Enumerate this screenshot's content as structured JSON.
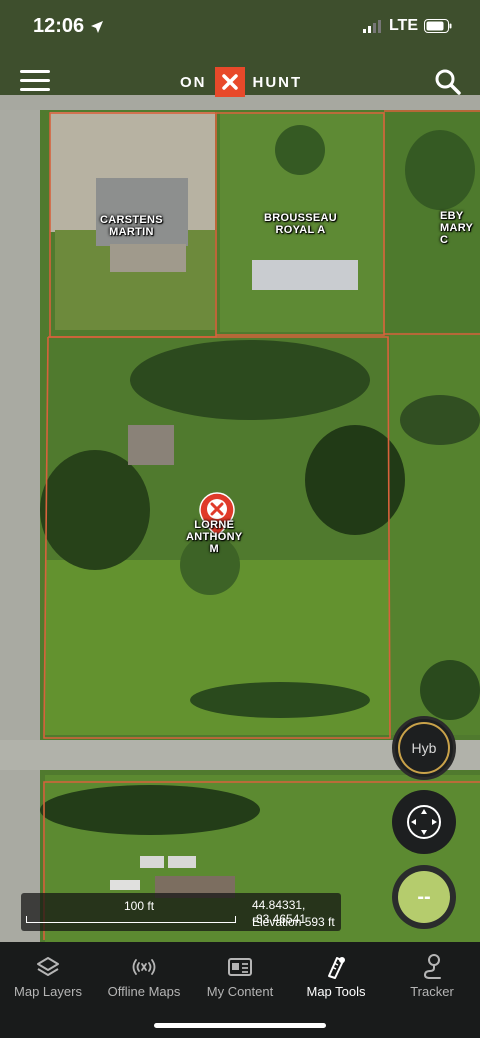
{
  "status_bar": {
    "time": "12:06",
    "network": "LTE"
  },
  "header": {
    "logo_left": "ON",
    "logo_right": "HUNT"
  },
  "parcels": [
    {
      "name": "CARSTENS\nMARTIN"
    },
    {
      "name": "BROUSSEAU\nROYAL A"
    },
    {
      "name": "EBY\nMARY C"
    },
    {
      "name": "LORNE\nANTHONY\nM"
    }
  ],
  "map_controls": {
    "layer_button": "Hyb",
    "gps_button": "--"
  },
  "scale": {
    "label": "100 ft"
  },
  "location": {
    "coords": "44.84331, -83.46541",
    "elevation": "Elevation 593 ft"
  },
  "tabs": [
    {
      "label": "Map Layers",
      "icon": "layers-icon",
      "active": false
    },
    {
      "label": "Offline Maps",
      "icon": "offline-icon",
      "active": false
    },
    {
      "label": "My Content",
      "icon": "content-icon",
      "active": false
    },
    {
      "label": "Map Tools",
      "icon": "tools-icon",
      "active": true
    },
    {
      "label": "Tracker",
      "icon": "tracker-icon",
      "active": false
    }
  ],
  "colors": {
    "brand": "#e8492a",
    "parcel_line": "#d8623c",
    "gps": "#b5cc6d",
    "layer_ring": "#c9a24a"
  }
}
